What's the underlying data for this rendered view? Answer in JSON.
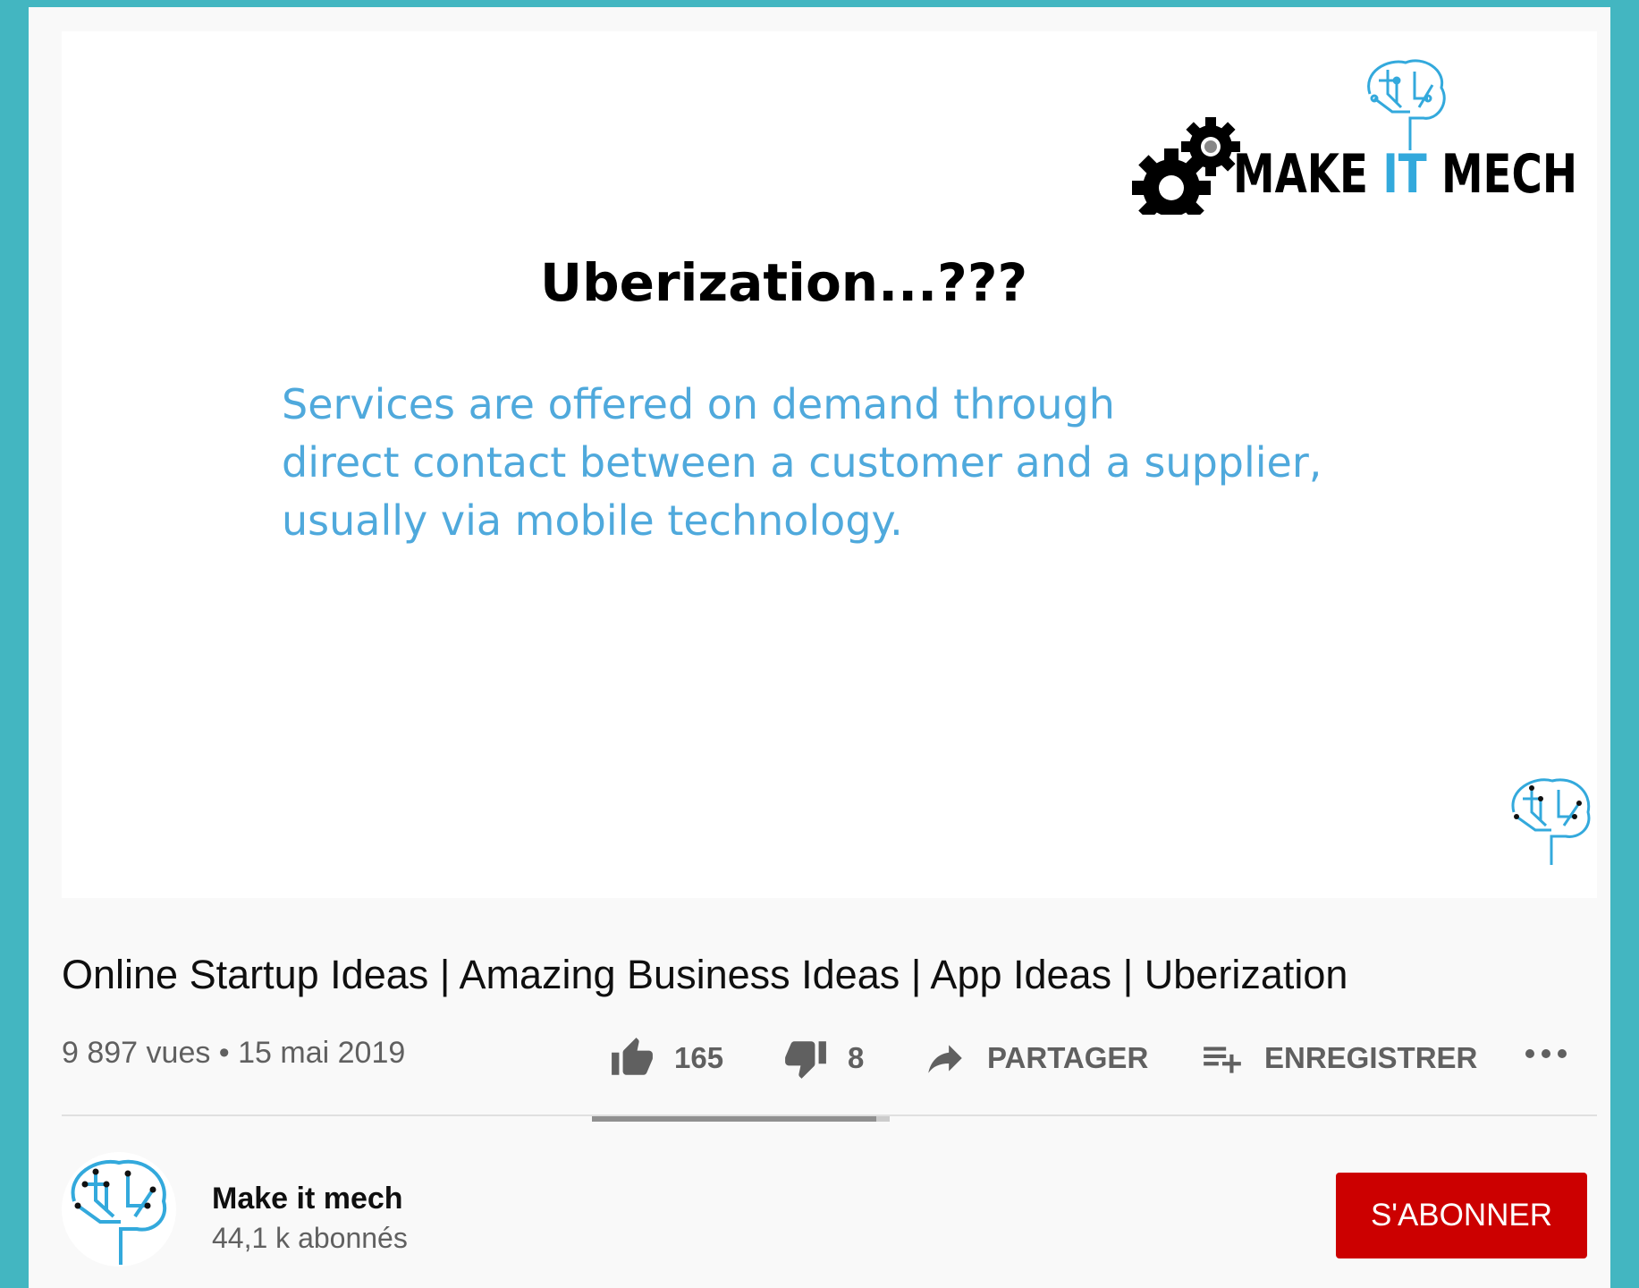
{
  "thumbnail": {
    "logo": {
      "part1": "MAKE ",
      "part2": "IT",
      "part3": " MECH",
      "accent_color": "#33a9dc"
    },
    "slide_title": "Uberization...???",
    "slide_lines": [
      "Services are offered on demand through",
      "direct contact between a customer and a supplier,",
      "usually via mobile technology."
    ],
    "text_color": "#4fa9dc",
    "icons": [
      "gears-icon",
      "brain-circuit-icon"
    ]
  },
  "video": {
    "title": "Online Startup Ideas | Amazing Business Ideas | App Ideas | Uberization",
    "stats": "9 897 vues • 15 mai 2019",
    "likes": "165",
    "dislikes": "8",
    "like_ratio": 0.954,
    "share_label": "PARTAGER",
    "save_label": "ENREGISTRER"
  },
  "channel": {
    "name": "Make it mech",
    "subscribers": "44,1 k abonnés",
    "subscribe_label": "S'ABONNER",
    "subscribe_color": "#cc0000"
  },
  "colors": {
    "background": "#43b6c1",
    "page": "#f9f9f9"
  }
}
